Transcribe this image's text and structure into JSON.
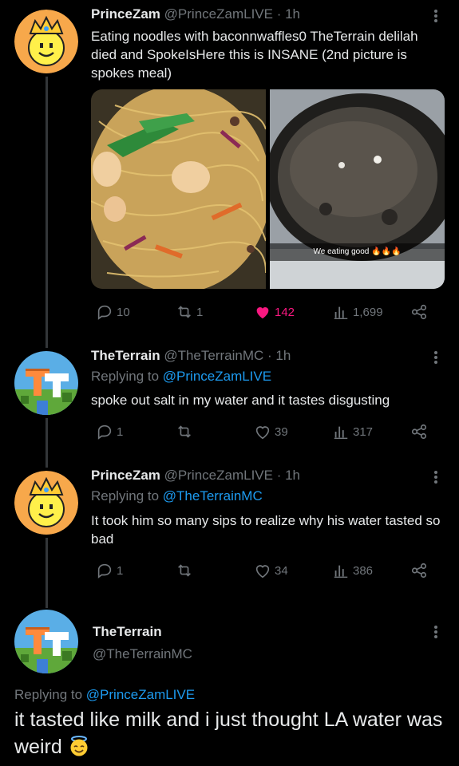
{
  "tweets": [
    {
      "name": "PrinceZam",
      "handle": "@PrinceZamLIVE",
      "time": "· 1h",
      "text": "Eating noodles with baconnwaffles0 TheTerrain delilah died and SpokeIsHere this is INSANE (2nd picture is spokes meal)",
      "image_caption": "We eating good 🔥🔥🔥",
      "reply_count": "10",
      "retweet_count": "1",
      "like_count": "142",
      "view_count": "1,699"
    },
    {
      "name": "TheTerrain",
      "handle": "@TheTerrainMC",
      "time": "· 1h",
      "replying_prefix": "Replying to ",
      "replying_to": "@PrinceZamLIVE",
      "text": "spoke out salt in my water and it tastes disgusting",
      "reply_count": "1",
      "retweet_count": "",
      "like_count": "39",
      "view_count": "317"
    },
    {
      "name": "PrinceZam",
      "handle": "@PrinceZamLIVE",
      "time": "· 1h",
      "replying_prefix": "Replying to ",
      "replying_to": "@TheTerrainMC",
      "text": "It took him so many sips to realize why his water tasted so bad",
      "reply_count": "1",
      "retweet_count": "",
      "like_count": "34",
      "view_count": "386"
    }
  ],
  "focused": {
    "name": "TheTerrain",
    "handle": "@TheTerrainMC",
    "replying_prefix": "Replying to ",
    "replying_to": "@PrinceZamLIVE",
    "text": "it tasted like milk and i just thought LA water was weird"
  },
  "colors": {
    "background": "#000000",
    "link": "#1d9bf0",
    "like_active": "#f91880",
    "muted": "#71767b"
  },
  "icons": [
    "reply-icon",
    "retweet-icon",
    "like-icon",
    "views-icon",
    "share-icon",
    "more-icon"
  ]
}
